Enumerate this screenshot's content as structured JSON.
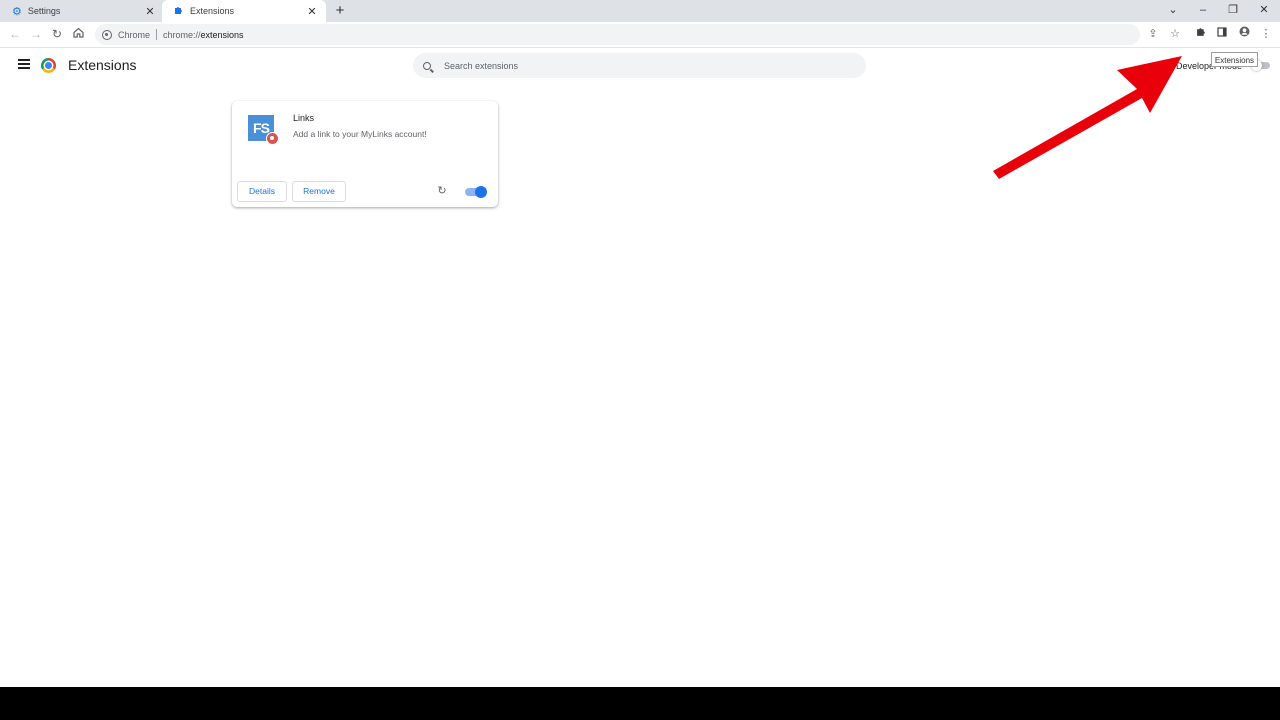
{
  "tabs": [
    {
      "title": "Settings",
      "icon": "gear-icon",
      "active": false
    },
    {
      "title": "Extensions",
      "icon": "puzzle-icon",
      "active": true
    }
  ],
  "omnibox": {
    "chip": "Chrome",
    "url_prefix": "chrome://",
    "url_host": "extensions"
  },
  "tooltip": "Extensions",
  "header": {
    "title": "Extensions",
    "search_placeholder": "Search extensions",
    "developer_mode_label": "Developer mode"
  },
  "extension": {
    "icon_text": "FS",
    "name": "Links",
    "description": "Add a link to your MyLinks account!",
    "details_label": "Details",
    "remove_label": "Remove",
    "enabled": true
  },
  "colors": {
    "accent": "#1a73e8",
    "annotation_arrow": "#e8000b"
  }
}
